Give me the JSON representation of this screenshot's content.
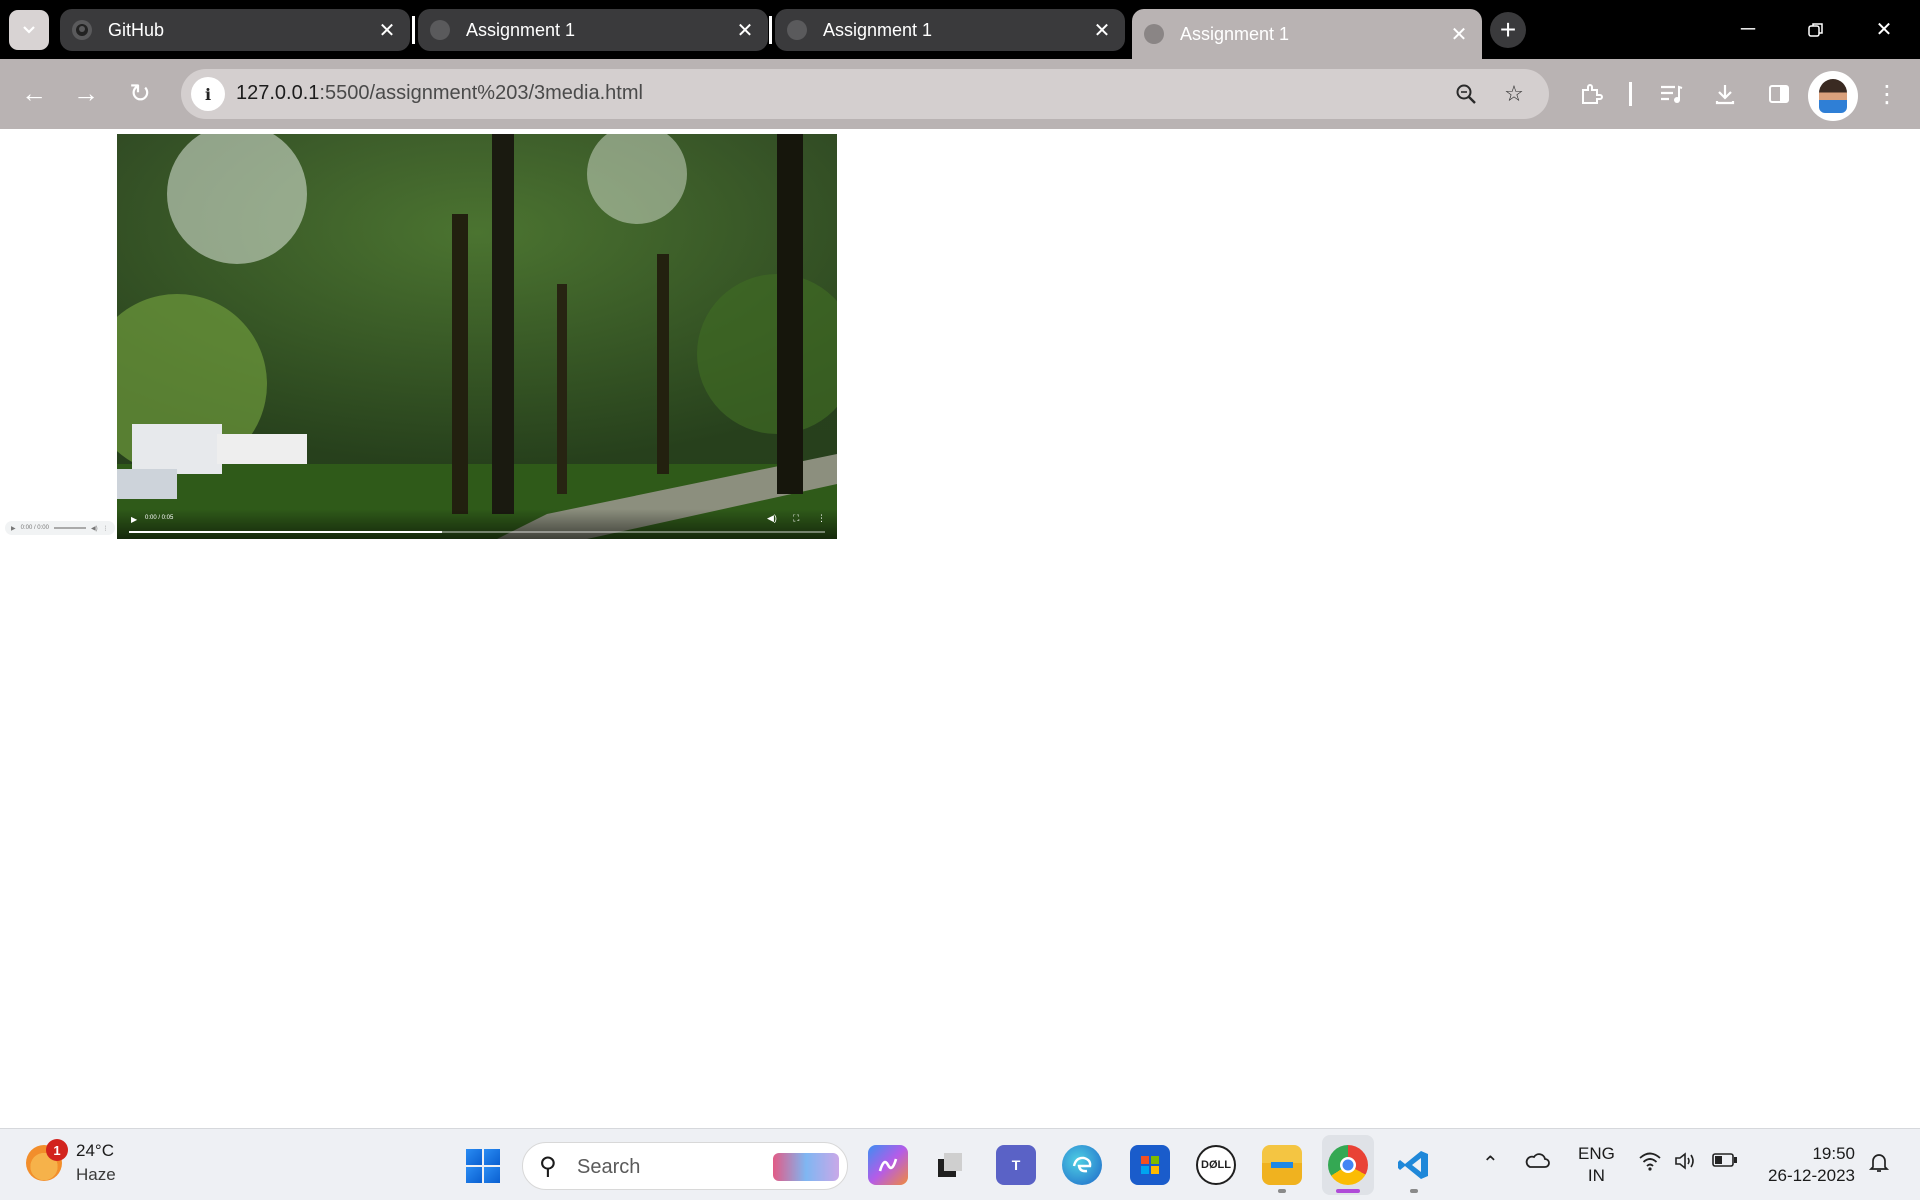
{
  "browser": {
    "tabs": [
      {
        "title": "GitHub",
        "active": false
      },
      {
        "title": "Assignment 1",
        "active": false
      },
      {
        "title": "Assignment 1",
        "active": false
      },
      {
        "title": "Assignment 1",
        "active": true
      }
    ],
    "address": {
      "host": "127.0.0.1",
      "path": ":5500/assignment%203/3media.html"
    }
  },
  "page": {
    "audio_player": {
      "time": "0:00 / 0:00"
    },
    "video_player": {
      "time": "0:00 / 0:05",
      "progress": 0.45
    }
  },
  "taskbar": {
    "weather": {
      "temp": "24°C",
      "condition": "Haze",
      "badge": "1"
    },
    "search_placeholder": "Search",
    "apps": [
      "copilot",
      "task-view",
      "teams",
      "edge",
      "store",
      "dell",
      "file-explorer",
      "chrome",
      "vscode"
    ],
    "language": {
      "line1": "ENG",
      "line2": "IN"
    },
    "clock": {
      "time": "19:50",
      "date": "26-12-2023"
    }
  }
}
